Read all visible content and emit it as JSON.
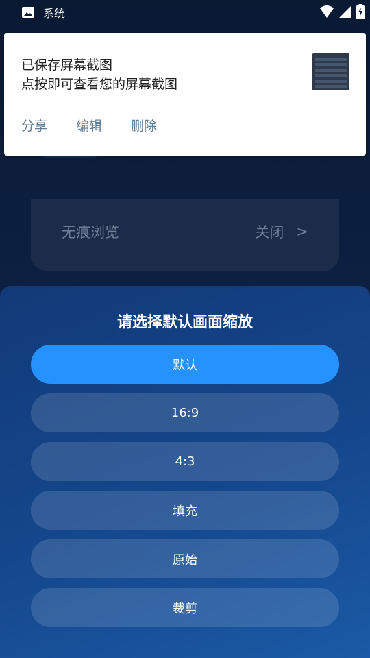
{
  "status_bar": {
    "app_label": "系统",
    "icons": [
      "image-icon",
      "wifi-icon",
      "signal-icon",
      "battery-charging-icon"
    ]
  },
  "notification": {
    "title": "已保存屏幕截图",
    "body": "点按即可查看您的屏幕截图",
    "actions": [
      "分享",
      "编辑",
      "删除"
    ]
  },
  "background": {
    "setting_label": "无痕浏览",
    "setting_value": "关闭",
    "setting_arrow": ">"
  },
  "sheet": {
    "title": "请选择默认画面缩放",
    "selected_index": 0,
    "options": [
      "默认",
      "16:9",
      "4:3",
      "填充",
      "原始",
      "裁剪"
    ]
  },
  "colors": {
    "selected_option": "#2592ff",
    "notification_action": "#5f7d95",
    "sheet_background": "#15478c"
  }
}
